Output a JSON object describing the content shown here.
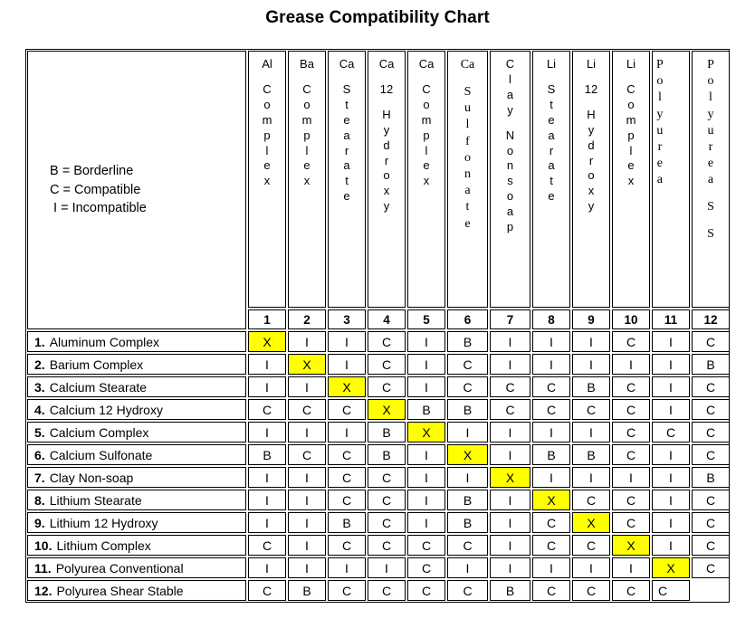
{
  "title": "Grease Compatibility Chart",
  "legend": {
    "lines": [
      "B = Borderline",
      "C = Compatible",
      " I = Incompatible"
    ],
    "text": "B = Borderline\nC = Compatible\n I = Incompatible"
  },
  "colors": {
    "highlight": "#FFFF00",
    "border": "#000000",
    "background": "#FFFFFF",
    "text": "#000000"
  },
  "columns": [
    {
      "number": "1",
      "top": "Al",
      "rest": "Complex",
      "font": "sans",
      "align": "center"
    },
    {
      "number": "2",
      "top": "Ba",
      "rest": "Complex",
      "font": "sans",
      "align": "center"
    },
    {
      "number": "3",
      "top": "Ca",
      "rest": "Stearate",
      "font": "sans",
      "align": "center"
    },
    {
      "number": "4",
      "top": "Ca",
      "rest": "12 Hydroxy",
      "font": "sans",
      "align": "center"
    },
    {
      "number": "5",
      "top": "Ca",
      "rest": "Complex",
      "font": "sans",
      "align": "center"
    },
    {
      "number": "6",
      "top": "Ca",
      "rest": "Sulfonate",
      "font": "serif",
      "align": "center"
    },
    {
      "number": "7",
      "top": "",
      "rest": "Clay Nonsoap",
      "font": "sans",
      "align": "center"
    },
    {
      "number": "8",
      "top": "Li",
      "rest": "Stearate",
      "font": "sans",
      "align": "center"
    },
    {
      "number": "9",
      "top": "Li",
      "rest": "12 Hydroxy",
      "font": "sans",
      "align": "center"
    },
    {
      "number": "10",
      "top": "Li",
      "rest": "Complex",
      "font": "sans",
      "align": "center"
    },
    {
      "number": "11",
      "top": "",
      "rest": "Polyurea",
      "font": "serif",
      "align": "left"
    },
    {
      "number": "12",
      "top": "",
      "rest": "Polyurea S S",
      "font": "serif",
      "align": "center"
    }
  ],
  "rows": [
    {
      "number": "1.",
      "label": "Aluminum Complex",
      "values": [
        "X",
        "I",
        "I",
        "C",
        "I",
        "B",
        "I",
        "I",
        "I",
        "C",
        "I",
        "C"
      ]
    },
    {
      "number": "2.",
      "label": "Barium Complex",
      "values": [
        "I",
        "X",
        "I",
        "C",
        "I",
        "C",
        "I",
        "I",
        "I",
        "I",
        "I",
        "B"
      ]
    },
    {
      "number": "3.",
      "label": "Calcium Stearate",
      "values": [
        "I",
        "I",
        "X",
        "C",
        "I",
        "C",
        "C",
        "C",
        "B",
        "C",
        "I",
        "C"
      ]
    },
    {
      "number": "4.",
      "label": "Calcium 12 Hydroxy",
      "values": [
        "C",
        "C",
        "C",
        "X",
        "B",
        "B",
        "C",
        "C",
        "C",
        "C",
        "I",
        "C"
      ]
    },
    {
      "number": "5.",
      "label": "Calcium Complex",
      "values": [
        "I",
        "I",
        "I",
        "B",
        "X",
        "I",
        "I",
        "I",
        "I",
        "C",
        "C",
        "C"
      ]
    },
    {
      "number": "6.",
      "label": "Calcium Sulfonate",
      "values": [
        "B",
        "C",
        "C",
        "B",
        "I",
        "X",
        "I",
        "B",
        "B",
        "C",
        "I",
        "C"
      ]
    },
    {
      "number": "7.",
      "label": "Clay Non-soap",
      "values": [
        "I",
        "I",
        "C",
        "C",
        "I",
        "I",
        "X",
        "I",
        "I",
        "I",
        "I",
        "B"
      ]
    },
    {
      "number": "8.",
      "label": "Lithium Stearate",
      "values": [
        "I",
        "I",
        "C",
        "C",
        "I",
        "B",
        "I",
        "X",
        "C",
        "C",
        "I",
        "C"
      ]
    },
    {
      "number": "9.",
      "label": "Lithium 12 Hydroxy",
      "values": [
        "I",
        "I",
        "B",
        "C",
        "I",
        "B",
        "I",
        "C",
        "X",
        "C",
        "I",
        "C"
      ]
    },
    {
      "number": "10.",
      "label": "Lithium Complex",
      "values": [
        "C",
        "I",
        "C",
        "C",
        "C",
        "C",
        "I",
        "C",
        "C",
        "X",
        "I",
        "C"
      ]
    },
    {
      "number": "11.",
      "label": "Polyurea Conventional",
      "values": [
        "I",
        "I",
        "I",
        "I",
        "C",
        "I",
        "I",
        "I",
        "I",
        "I",
        "X",
        "C"
      ]
    },
    {
      "number": "12.",
      "label": "Polyurea Shear Stable",
      "values": [
        "C",
        "B",
        "C",
        "C",
        "C",
        "C",
        "B",
        "C",
        "C",
        "C",
        "C",
        ""
      ]
    }
  ],
  "chart_data": {
    "type": "table",
    "title": "Grease Compatibility Chart",
    "legend_entries": [
      {
        "code": "B",
        "meaning": "Borderline"
      },
      {
        "code": "C",
        "meaning": "Compatible"
      },
      {
        "code": "I",
        "meaning": "Incompatible"
      }
    ],
    "column_headers": [
      "Al Complex",
      "Ba Complex",
      "Ca Stearate",
      "Ca 12 Hydroxy",
      "Ca Complex",
      "Ca Sulfonate",
      "Clay Nonsoap",
      "Li Stearate",
      "Li 12 Hydroxy",
      "Li Complex",
      "Polyurea",
      "Polyurea S S"
    ],
    "column_numbers": [
      "1",
      "2",
      "3",
      "4",
      "5",
      "6",
      "7",
      "8",
      "9",
      "10",
      "11",
      "12"
    ],
    "row_headers": [
      "1. Aluminum Complex",
      "2. Barium Complex",
      "3. Calcium Stearate",
      "4. Calcium 12 Hydroxy",
      "5. Calcium Complex",
      "6. Calcium Sulfonate",
      "7. Clay Non-soap",
      "8. Lithium Stearate",
      "9. Lithium 12 Hydroxy",
      "10. Lithium Complex",
      "11. Polyurea Conventional",
      "12. Polyurea Shear Stable"
    ],
    "matrix": [
      [
        "X",
        "I",
        "I",
        "C",
        "I",
        "B",
        "I",
        "I",
        "I",
        "C",
        "I",
        "C"
      ],
      [
        "I",
        "X",
        "I",
        "C",
        "I",
        "C",
        "I",
        "I",
        "I",
        "I",
        "I",
        "B"
      ],
      [
        "I",
        "I",
        "X",
        "C",
        "I",
        "C",
        "C",
        "C",
        "B",
        "C",
        "I",
        "C"
      ],
      [
        "C",
        "C",
        "C",
        "X",
        "B",
        "B",
        "C",
        "C",
        "C",
        "C",
        "I",
        "C"
      ],
      [
        "I",
        "I",
        "I",
        "B",
        "X",
        "I",
        "I",
        "I",
        "I",
        "C",
        "C",
        "C"
      ],
      [
        "B",
        "C",
        "C",
        "B",
        "I",
        "X",
        "I",
        "B",
        "B",
        "C",
        "I",
        "C"
      ],
      [
        "I",
        "I",
        "C",
        "C",
        "I",
        "I",
        "X",
        "I",
        "I",
        "I",
        "I",
        "B"
      ],
      [
        "I",
        "I",
        "C",
        "C",
        "I",
        "B",
        "I",
        "X",
        "C",
        "C",
        "I",
        "C"
      ],
      [
        "I",
        "I",
        "B",
        "C",
        "I",
        "B",
        "I",
        "C",
        "X",
        "C",
        "I",
        "C"
      ],
      [
        "C",
        "I",
        "C",
        "C",
        "C",
        "C",
        "I",
        "C",
        "C",
        "X",
        "I",
        "C"
      ],
      [
        "I",
        "I",
        "I",
        "I",
        "C",
        "I",
        "I",
        "I",
        "I",
        "I",
        "X",
        "C"
      ],
      [
        "C",
        "B",
        "C",
        "C",
        "C",
        "C",
        "B",
        "C",
        "C",
        "C",
        "C",
        ""
      ]
    ],
    "diagonal_marker": "X",
    "diagonal_highlight_color": "#FFFF00",
    "notes": "Diagonal self-compatibility cells marked X on yellow background. Row 12 / column 12 cell is blank."
  }
}
